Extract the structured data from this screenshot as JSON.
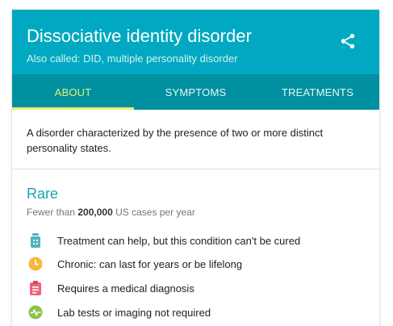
{
  "header": {
    "title": "Dissociative identity disorder",
    "subtitle": "Also called: DID, multiple personality disorder",
    "share_icon": "share-icon"
  },
  "tabs": [
    {
      "label": "ABOUT",
      "active": true
    },
    {
      "label": "SYMPTOMS",
      "active": false
    },
    {
      "label": "TREATMENTS",
      "active": false
    }
  ],
  "description": "A disorder characterized by the presence of two or more distinct personality states.",
  "rarity": {
    "label": "Rare",
    "prefix": "Fewer than",
    "count": "200,000",
    "suffix": "US cases per year"
  },
  "facts": [
    {
      "icon": "medicine-bottle-icon",
      "color": "#4fb3bf",
      "text": "Treatment can help, but this condition can't be cured"
    },
    {
      "icon": "clock-icon",
      "color": "#f6b83c",
      "text": "Chronic: can last for years or be lifelong"
    },
    {
      "icon": "clipboard-icon",
      "color": "#f06277",
      "text": "Requires a medical diagnosis"
    },
    {
      "icon": "pulse-icon",
      "color": "#8bc34a",
      "text": "Lab tests or imaging not required"
    }
  ],
  "colors": {
    "header": "#00a9c1",
    "tabs": "#00909f",
    "active_tab": "#e8f06c",
    "rare": "#1da1b3"
  }
}
